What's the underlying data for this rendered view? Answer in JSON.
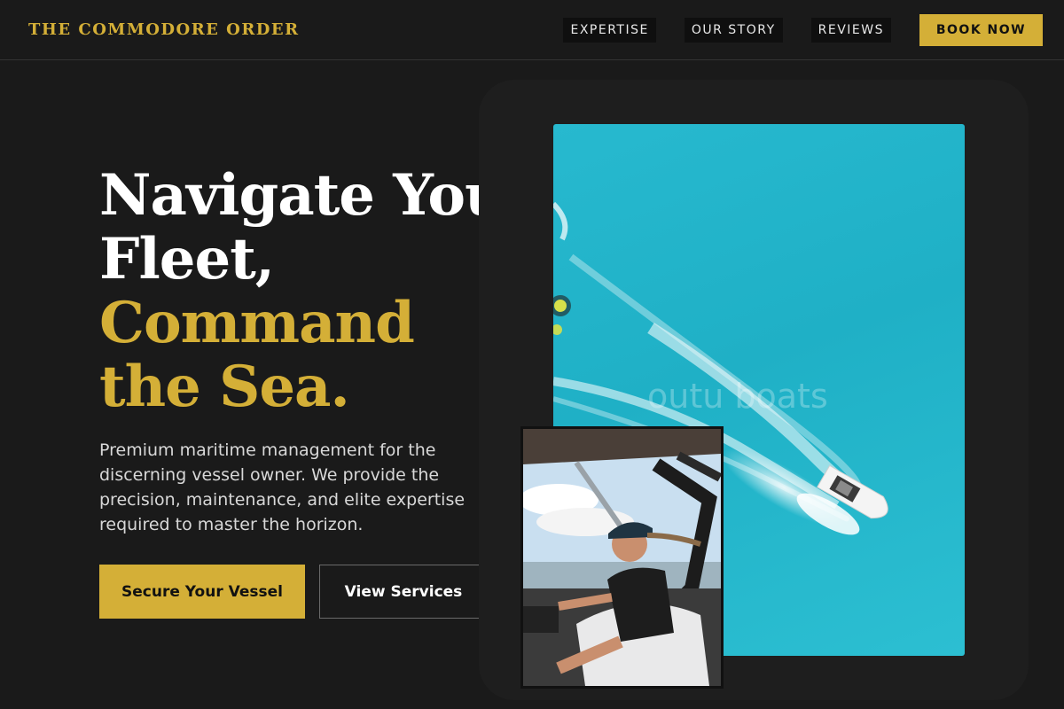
{
  "nav": {
    "brand": "THE COMMODORE ORDER",
    "links": [
      "EXPERTISE",
      "OUR STORY",
      "REVIEWS"
    ],
    "cta": "BOOK NOW"
  },
  "hero": {
    "title_lines": [
      "Navigate Your",
      "Fleet,",
      "Command",
      "the Sea."
    ],
    "description": "Premium maritime management for the discerning vessel owner. We provide the precision, maintenance, and elite expertise required to master the horizon.",
    "primary_button": "Secure Your Vessel",
    "secondary_button": "View Services"
  },
  "images": {
    "main_watermark": "outu boats",
    "main_alt": "Aerial view of speedboat on turquoise water",
    "inset_alt": "Man driving a boat with wind in his hair"
  },
  "colors": {
    "accent": "#d4af37",
    "background": "#1a1a1a",
    "water": "#27b9cf"
  }
}
